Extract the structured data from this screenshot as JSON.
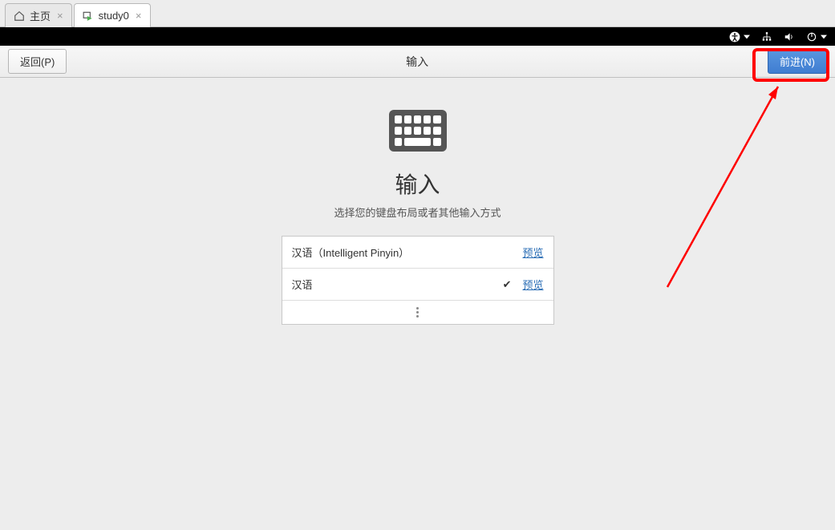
{
  "tabs": [
    {
      "label": "主页"
    },
    {
      "label": "study0"
    }
  ],
  "header": {
    "back_label": "返回(P)",
    "title": "输入",
    "next_label": "前进(N)"
  },
  "main": {
    "title": "输入",
    "subtitle": "选择您的键盘布局或者其他输入方式"
  },
  "input_options": [
    {
      "label": "汉语（Intelligent Pinyin）",
      "selected": false,
      "preview": "预览"
    },
    {
      "label": "汉语",
      "selected": true,
      "preview": "预览"
    }
  ]
}
